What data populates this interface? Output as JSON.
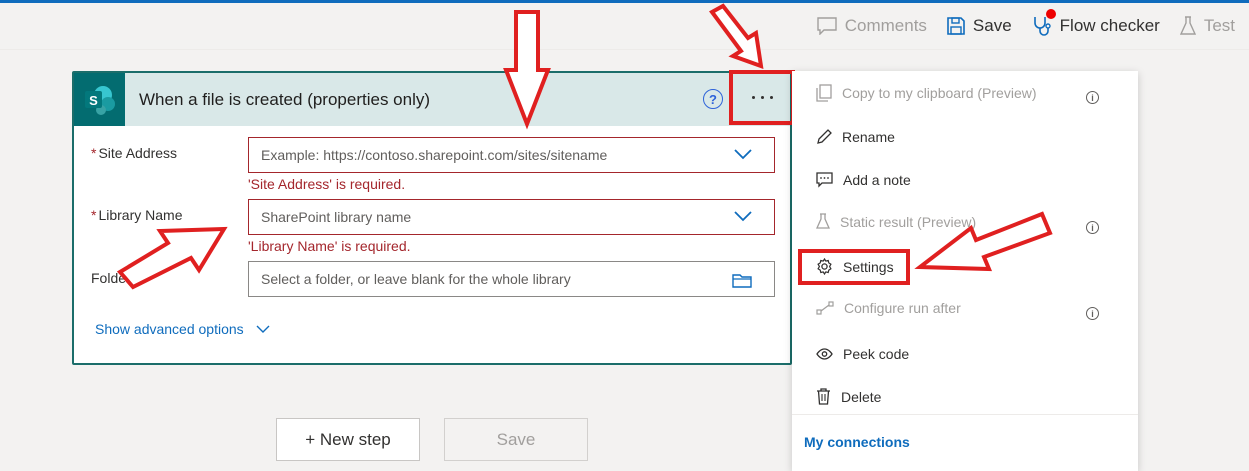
{
  "topbar": {
    "comments_label": "Comments",
    "save_label": "Save",
    "flow_checker_label": "Flow checker",
    "test_label": "Test"
  },
  "card": {
    "title": "When a file is created (properties only)",
    "connector_icon": "sharepoint-icon",
    "fields": {
      "site_address": {
        "label": "Site Address",
        "placeholder": "Example: https://contoso.sharepoint.com/sites/sitename",
        "error": "'Site Address' is required."
      },
      "library_name": {
        "label": "Library Name",
        "placeholder": "SharePoint library name",
        "error": "'Library Name' is required."
      },
      "folder": {
        "label": "Folder",
        "placeholder": "Select a folder, or leave blank for the whole library"
      }
    },
    "advanced_label": "Show advanced options"
  },
  "actions": {
    "new_step_label": "+ New step",
    "save_label": "Save"
  },
  "menu": {
    "items": [
      {
        "label": "Copy to my clipboard (Preview)",
        "icon": "copy-icon",
        "disabled": true
      },
      {
        "label": "Rename",
        "icon": "pencil-icon",
        "disabled": false
      },
      {
        "label": "Add a note",
        "icon": "note-icon",
        "disabled": false
      },
      {
        "label": "Static result (Preview)",
        "icon": "flask-icon",
        "disabled": true
      },
      {
        "label": "Settings",
        "icon": "gear-icon",
        "disabled": false
      },
      {
        "label": "Configure run after",
        "icon": "run-after-icon",
        "disabled": true
      },
      {
        "label": "Peek code",
        "icon": "eye-icon",
        "disabled": false
      },
      {
        "label": "Delete",
        "icon": "trash-icon",
        "disabled": false
      }
    ],
    "connections_label": "My connections"
  },
  "colors": {
    "accent": "#0f6cbd",
    "card_border": "#1b6d6a",
    "header_bg": "#d9e8e8",
    "error": "#a4262c",
    "annotation": "#e02020"
  }
}
